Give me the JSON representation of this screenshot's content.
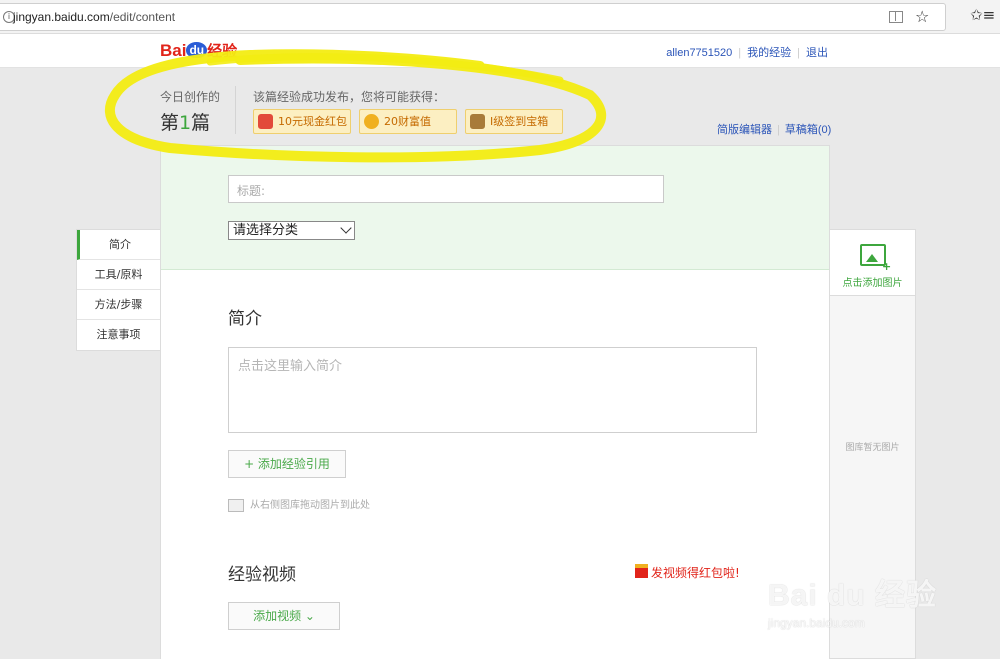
{
  "browser": {
    "url_host": "jingyan.baidu.com",
    "url_path": "/edit/content",
    "info_icon": "i"
  },
  "header": {
    "logo_bai": "Bai",
    "logo_du": "du",
    "logo_jy": "经验",
    "username": "allen7751520",
    "my_exp": "我的经验",
    "logout": "退出"
  },
  "stats": {
    "today_label": "今日创作的",
    "today_prefix": "第",
    "today_num": "1",
    "today_suffix": "篇",
    "reward_label": "该篇经验成功发布，您将可能获得：",
    "badges": [
      {
        "label": "10元现金红包",
        "icon": "red-envelope-icon"
      },
      {
        "label": "20财富值",
        "icon": "coin-icon"
      },
      {
        "label": "I级签到宝箱",
        "icon": "treasure-chest-icon"
      }
    ]
  },
  "editor_links": {
    "simple_editor": "简版编辑器",
    "drafts": "草稿箱(0)"
  },
  "editor": {
    "title_placeholder": "标题:",
    "category": "请选择分类",
    "intro_heading": "简介",
    "intro_placeholder": "点击这里输入简介",
    "add_ref": "+ 添加经验引用",
    "drag_hint": "从右侧图库拖动图片到此处",
    "video_heading": "经验视频",
    "video_promo": "发视频得红包啦!",
    "add_video": "添加视频 ⌄"
  },
  "leftnav": [
    "简介",
    "工具/原料",
    "方法/步骤",
    "注意事项"
  ],
  "gallery": {
    "add_label": "点击添加图片",
    "plus": "+",
    "empty": "图库暂无图片"
  },
  "watermark": {
    "brand": "Bai du 经验",
    "url": "jingyan.baidu.com"
  },
  "colors": {
    "highlight": "#f5ee1a",
    "accent_green": "#3da63d",
    "link_blue": "#2b55b8",
    "brand_red": "#e1241a"
  }
}
